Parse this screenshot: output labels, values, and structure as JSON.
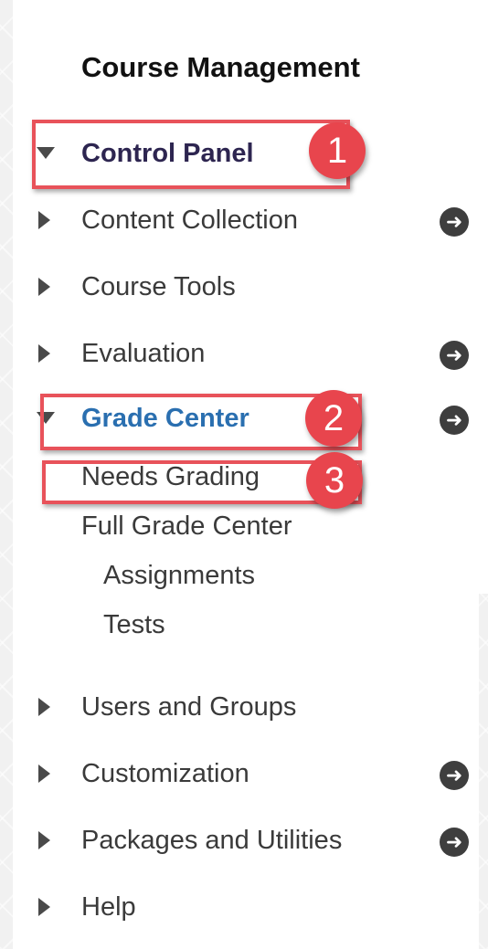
{
  "menu": {
    "heading": "Course Management",
    "items": [
      {
        "label": "Control Panel",
        "expanded": true
      },
      {
        "label": "Content Collection",
        "has_go": true
      },
      {
        "label": "Course Tools"
      },
      {
        "label": "Evaluation",
        "has_go": true
      },
      {
        "label": "Grade Center",
        "expanded": true,
        "has_go": true,
        "children": [
          "Needs Grading",
          "Full Grade Center",
          "Assignments",
          "Tests"
        ]
      },
      {
        "label": "Users and Groups"
      },
      {
        "label": "Customization",
        "has_go": true
      },
      {
        "label": "Packages and Utilities",
        "has_go": true
      },
      {
        "label": "Help"
      }
    ],
    "go_icon": "arrow-right-circle-icon"
  },
  "annotations": {
    "badge1": "1",
    "badge2": "2",
    "badge3": "3",
    "highlight_color": "#e8525a"
  },
  "colors": {
    "heading": "#111111",
    "control_panel": "#2d2550",
    "grade_center": "#2a6fb0",
    "text": "#3a3a3a"
  }
}
